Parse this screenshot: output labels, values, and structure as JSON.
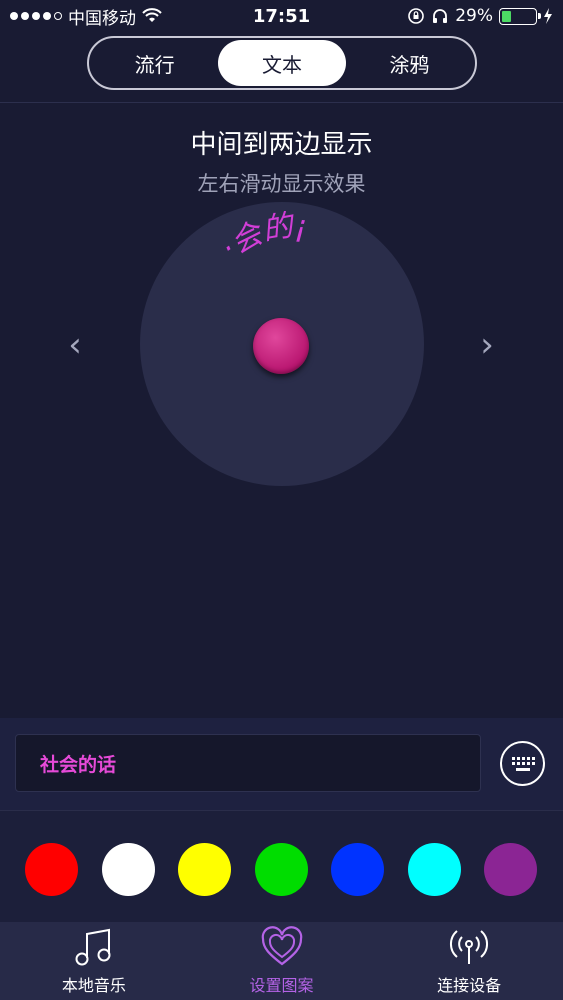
{
  "status_bar": {
    "carrier": "中国移动",
    "time": "17:51",
    "battery": "29%",
    "battery_level": 0.29
  },
  "tabs_top": [
    {
      "label": "流行",
      "active": false
    },
    {
      "label": "文本",
      "active": true
    },
    {
      "label": "涂鸦",
      "active": false
    }
  ],
  "main": {
    "title": "中间到两边显示",
    "subtitle": "左右滑动显示效果",
    "preview_text": "·会的¡",
    "arrow_left": "‹",
    "arrow_right": "›"
  },
  "input": {
    "value": "社会的话",
    "text_color": "#e64ad8"
  },
  "colors": [
    "#ff0000",
    "#ffffff",
    "#ffff00",
    "#00dd00",
    "#0033ff",
    "#00ffff",
    "#8b2594"
  ],
  "tab_bar": [
    {
      "label": "本地音乐",
      "icon": "music-note-icon",
      "active": false
    },
    {
      "label": "设置图案",
      "icon": "heart-pattern-icon",
      "active": true
    },
    {
      "label": "连接设备",
      "icon": "broadcast-icon",
      "active": false
    }
  ],
  "accent": "#b463e6"
}
